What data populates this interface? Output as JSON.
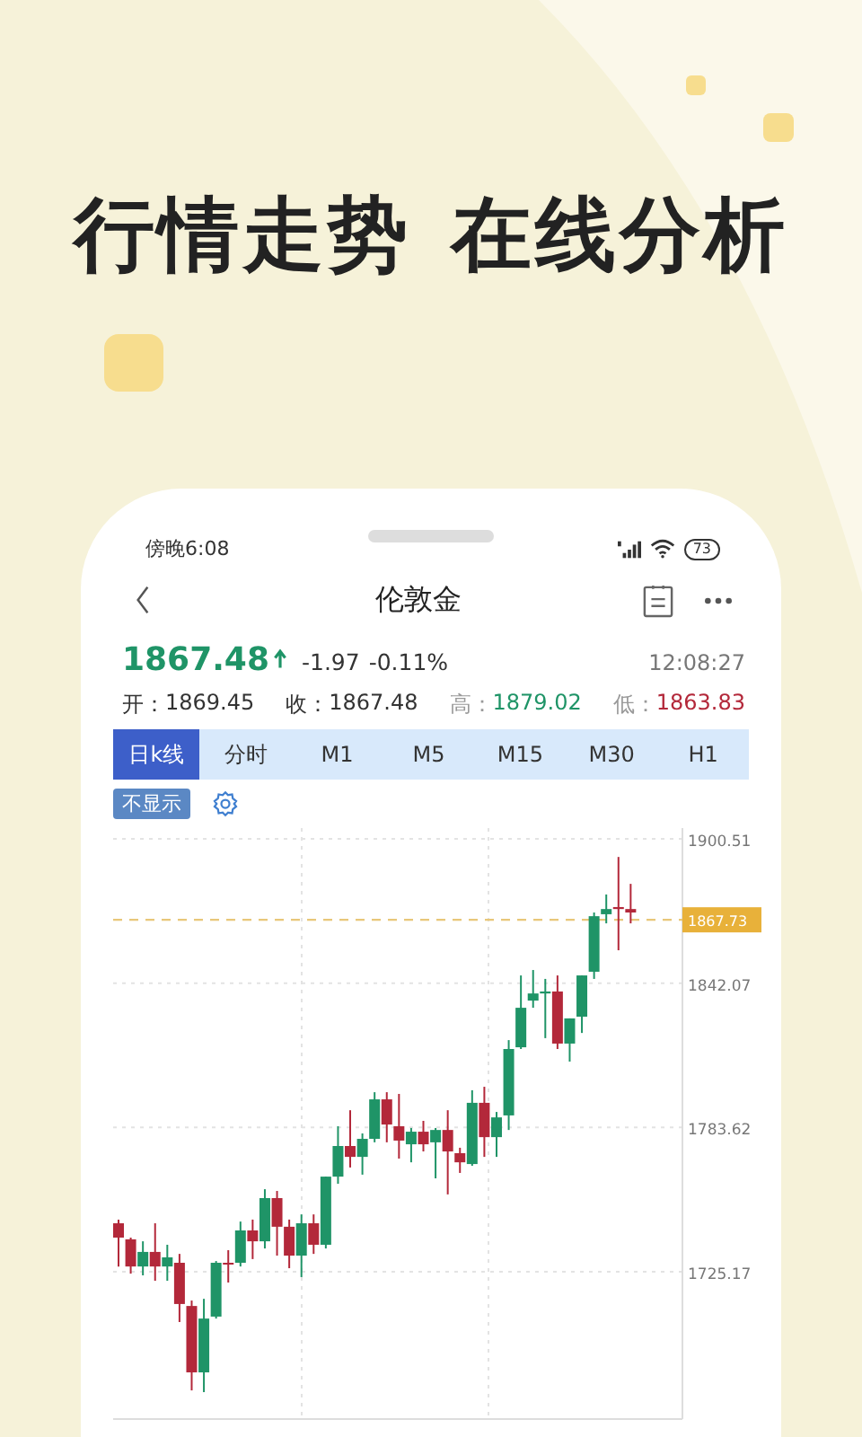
{
  "headline": [
    "行情走势",
    "在线分析"
  ],
  "status_bar": {
    "time": "傍晚6:08",
    "battery": "73"
  },
  "nav": {
    "title": "伦敦金"
  },
  "quote": {
    "price": "1867.48",
    "change": "-1.97",
    "percent": "-0.11%",
    "time": "12:08:27"
  },
  "ohlc": [
    {
      "label": "开：",
      "value": "1869.45",
      "kind": "plain"
    },
    {
      "label": "收：",
      "value": "1867.48",
      "kind": "plain"
    },
    {
      "label": "高：",
      "value": "1879.02",
      "kind": "high"
    },
    {
      "label": "低：",
      "value": "1863.83",
      "kind": "low"
    }
  ],
  "tabs": [
    {
      "label": "日k线",
      "selected": true
    },
    {
      "label": "分时",
      "selected": false
    },
    {
      "label": "M1",
      "selected": false
    },
    {
      "label": "M5",
      "selected": false
    },
    {
      "label": "M15",
      "selected": false
    },
    {
      "label": "M30",
      "selected": false
    },
    {
      "label": "H1",
      "selected": false
    }
  ],
  "indicator_toggle": "不显示",
  "chart": {
    "chart_data": {
      "type": "candlestick",
      "ylim": [
        1665.5,
        1904.9
      ],
      "yticks": [
        1900.51,
        1842.07,
        1783.62,
        1725.17
      ],
      "grid": true,
      "ref_lines": [
        {
          "axis": "y",
          "value": 1867.73,
          "label": "1867.73"
        }
      ],
      "ohlc": [
        [
          1744.8,
          1746.3,
          1727.3,
          1739.0
        ],
        [
          1738.3,
          1739.0,
          1724.4,
          1727.3
        ],
        [
          1727.3,
          1737.5,
          1723.7,
          1733.2
        ],
        [
          1733.2,
          1744.8,
          1721.5,
          1727.3
        ],
        [
          1727.3,
          1736.1,
          1721.5,
          1731.0
        ],
        [
          1728.8,
          1732.4,
          1704.8,
          1712.1
        ],
        [
          1711.3,
          1713.5,
          1677.1,
          1684.4
        ],
        [
          1684.4,
          1714.2,
          1676.4,
          1706.2
        ],
        [
          1707.0,
          1729.5,
          1706.2,
          1728.8
        ],
        [
          1728.8,
          1733.9,
          1720.8,
          1728.1
        ],
        [
          1728.8,
          1745.5,
          1727.3,
          1741.9
        ],
        [
          1741.9,
          1746.3,
          1730.3,
          1737.5
        ],
        [
          1737.5,
          1758.6,
          1734.6,
          1755.0
        ],
        [
          1755.0,
          1757.9,
          1731.7,
          1743.4
        ],
        [
          1743.4,
          1746.3,
          1726.6,
          1731.7
        ],
        [
          1731.7,
          1748.4,
          1723.0,
          1744.8
        ],
        [
          1744.8,
          1748.4,
          1732.4,
          1736.1
        ],
        [
          1736.1,
          1763.7,
          1734.6,
          1763.7
        ],
        [
          1763.7,
          1784.1,
          1760.8,
          1776.1
        ],
        [
          1776.1,
          1790.6,
          1767.4,
          1771.7
        ],
        [
          1771.7,
          1781.2,
          1764.5,
          1779.0
        ],
        [
          1779.0,
          1797.9,
          1777.6,
          1795.0
        ],
        [
          1795.0,
          1797.9,
          1777.6,
          1784.8
        ],
        [
          1784.1,
          1797.2,
          1771.0,
          1778.3
        ],
        [
          1776.8,
          1783.4,
          1769.5,
          1781.9
        ],
        [
          1781.9,
          1786.3,
          1773.9,
          1776.8
        ],
        [
          1777.6,
          1783.4,
          1763.0,
          1782.6
        ],
        [
          1782.6,
          1790.6,
          1756.5,
          1773.9
        ],
        [
          1773.2,
          1775.4,
          1765.2,
          1769.5
        ],
        [
          1768.8,
          1798.7,
          1768.1,
          1793.6
        ],
        [
          1793.6,
          1800.1,
          1771.7,
          1779.7
        ],
        [
          1779.7,
          1789.9,
          1771.7,
          1787.7
        ],
        [
          1788.5,
          1819.0,
          1782.6,
          1815.4
        ],
        [
          1816.1,
          1845.2,
          1815.4,
          1832.1
        ],
        [
          1835.0,
          1847.4,
          1832.1,
          1837.9
        ],
        [
          1837.9,
          1843.8,
          1819.8,
          1838.7
        ],
        [
          1838.7,
          1845.2,
          1815.4,
          1817.6
        ],
        [
          1817.6,
          1827.8,
          1810.3,
          1827.8
        ],
        [
          1828.5,
          1845.2,
          1821.9,
          1845.2
        ],
        [
          1846.7,
          1870.7,
          1843.8,
          1869.2
        ],
        [
          1870.0,
          1878.0,
          1866.3,
          1872.1
        ],
        [
          1872.9,
          1893.2,
          1855.4,
          1872.1
        ],
        [
          1872.1,
          1882.3,
          1866.3,
          1870.7
        ]
      ]
    }
  }
}
